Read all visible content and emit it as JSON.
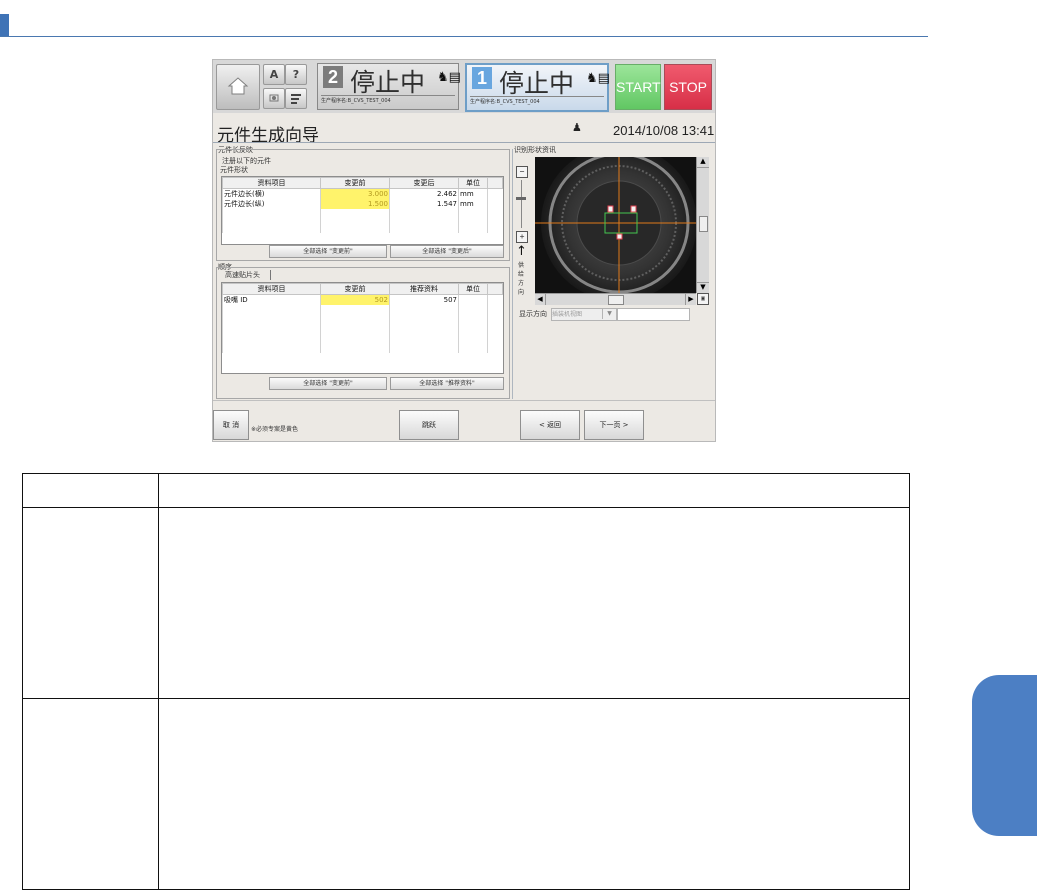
{
  "machine_panels": [
    {
      "number": "2",
      "status": "停止中",
      "program": "生产程序名:B_CVS_TEST_004"
    },
    {
      "number": "1",
      "status": "停止中",
      "program": "生产程序名:B_CVS_TEST_004"
    }
  ],
  "toolbar": {
    "start_label": "START",
    "stop_label": "STOP",
    "small_buttons": [
      "A",
      "?"
    ]
  },
  "page": {
    "title": "元件生成向导",
    "datetime": "2014/10/08 13:41"
  },
  "component_section": {
    "title": "元件长反映",
    "subtitle": "注册以下的元件",
    "shape_label": "元件形状",
    "headers": [
      "资料项目",
      "变更前",
      "变更后",
      "单位"
    ],
    "rows": [
      {
        "item": "元件边长(横)",
        "before": "3.000",
        "after": "2.462",
        "unit": "mm"
      },
      {
        "item": "元件边长(纵)",
        "before": "1.500",
        "after": "1.547",
        "unit": "mm"
      }
    ],
    "select_before": "全部选择 \"变更前\"",
    "select_after": "全部选择 \"变更后\""
  },
  "order_section": {
    "title": "顺序",
    "tab_label": "高速贴片头",
    "headers": [
      "资料项目",
      "变更前",
      "推荐资料",
      "单位"
    ],
    "rows": [
      {
        "item": "吸嘴 ID",
        "before": "502",
        "recommended": "507",
        "unit": ""
      }
    ],
    "select_before": "全部选择 \"变更前\"",
    "select_recommended": "全部选择 \"推荐资料\""
  },
  "recognition": {
    "title": "识别形状资讯",
    "feed_direction": [
      "供",
      "给",
      "方",
      "向"
    ],
    "display_direction_label": "显示方向",
    "display_direction_value": "插装机视图"
  },
  "footer": {
    "cancel": "取 消",
    "note": "※必须专案是黄色",
    "skip": "跳跃",
    "back": "< 返回",
    "next": "下一页 >"
  },
  "colors": {
    "accent_blue": "#3f73b6",
    "highlight_yellow": "#fff36b",
    "start_green": "#61c763",
    "stop_red": "#d72f47"
  }
}
